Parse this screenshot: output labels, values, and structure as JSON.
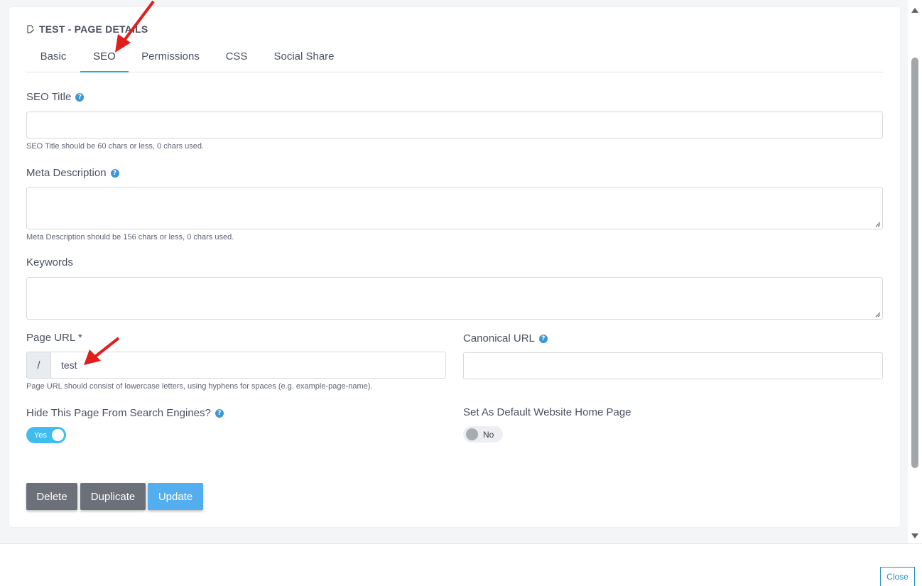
{
  "page": {
    "title": "TEST - PAGE DETAILS",
    "title_icon": "edit-page-icon"
  },
  "tabs": [
    {
      "label": "Basic",
      "active": false
    },
    {
      "label": "SEO",
      "active": true
    },
    {
      "label": "Permissions",
      "active": false
    },
    {
      "label": "CSS",
      "active": false
    },
    {
      "label": "Social Share",
      "active": false
    }
  ],
  "seo_title": {
    "label": "SEO Title",
    "value": "",
    "hint": "SEO Title should be 60 chars or less, 0 chars used."
  },
  "meta_description": {
    "label": "Meta Description",
    "value": "",
    "hint": "Meta Description should be 156 chars or less, 0 chars used."
  },
  "keywords": {
    "label": "Keywords",
    "value": ""
  },
  "page_url": {
    "label": "Page URL *",
    "prefix": "/",
    "value": "test",
    "hint": "Page URL should consist of lowercase letters, using hyphens for spaces (e.g. example-page-name)."
  },
  "canonical_url": {
    "label": "Canonical URL",
    "value": ""
  },
  "hide_search": {
    "label": "Hide This Page From Search Engines?",
    "state": "Yes"
  },
  "default_home": {
    "label": "Set As Default Website Home Page",
    "state": "No"
  },
  "buttons": {
    "delete": "Delete",
    "duplicate": "Duplicate",
    "update": "Update"
  },
  "footer": {
    "close": "Close"
  },
  "colors": {
    "accent": "#35a2dc",
    "update_button": "#53aef0",
    "gray_button": "#6b7079",
    "toggle_on": "#3fbcf0",
    "annotation_arrow": "#e11d1d"
  }
}
